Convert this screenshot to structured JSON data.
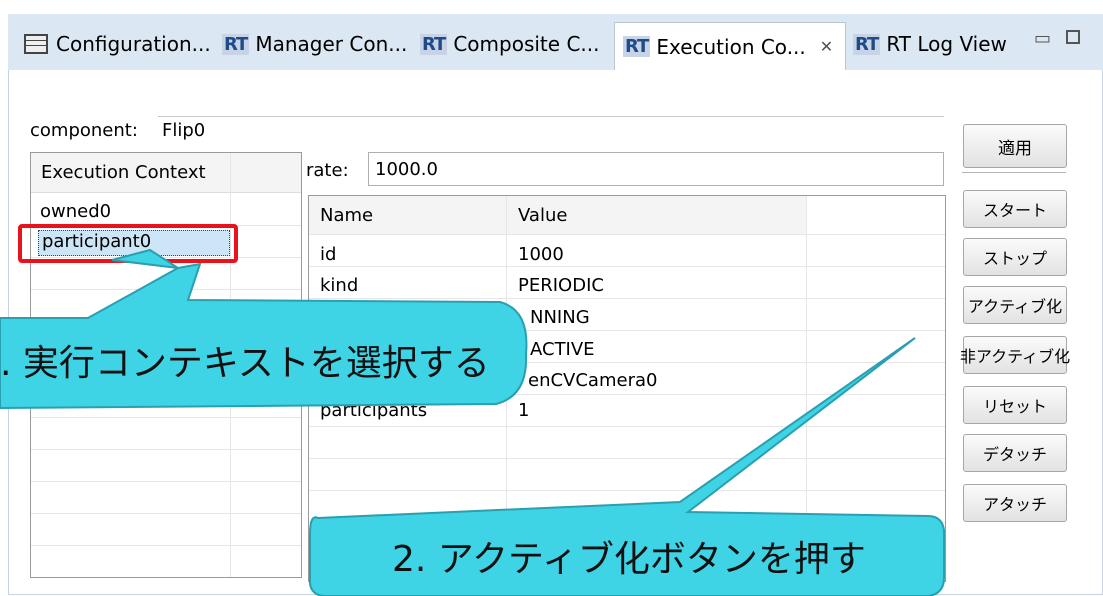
{
  "tabs": [
    {
      "label": "Configuration...",
      "icon": "config-view-icon"
    },
    {
      "label": "Manager Con...",
      "icon": "rt-icon"
    },
    {
      "label": "Composite C...",
      "icon": "rt-icon"
    },
    {
      "label": "Execution Co...",
      "icon": "rt-icon",
      "active": true
    },
    {
      "label": "RT Log View",
      "icon": "rt-icon"
    }
  ],
  "rt_badge": "RT",
  "component": {
    "label": "component:",
    "value": "Flip0"
  },
  "ec_list": {
    "header": "Execution Context",
    "items": [
      "owned0",
      "participant0"
    ],
    "selected": "participant0"
  },
  "rate": {
    "label": "rate:",
    "value": "1000.0"
  },
  "properties": {
    "headers": [
      "Name",
      "Value"
    ],
    "rows": [
      {
        "name": "id",
        "value": "1000"
      },
      {
        "name": "kind",
        "value": "PERIODIC"
      },
      {
        "name": "",
        "value": "NNING"
      },
      {
        "name": "",
        "value": "ACTIVE"
      },
      {
        "name": "",
        "value": "enCVCamera0"
      },
      {
        "name": "participants",
        "value": "1"
      }
    ]
  },
  "buttons": {
    "apply": "適用",
    "start": "スタート",
    "stop": "ストップ",
    "activate": "アクティブ化",
    "deactivate": "非アクティブ化",
    "reset": "リセット",
    "detach": "デタッチ",
    "attach": "アタッチ"
  },
  "callouts": {
    "step1": ". 実行コンテキストを選択する",
    "step2": "2. アクティブ化ボタンを押す"
  },
  "colors": {
    "highlight": "#e8131c",
    "callout_fill": "#3fd3e6",
    "tabbar": "#dbe7f3",
    "selection": "#cde6f7"
  }
}
